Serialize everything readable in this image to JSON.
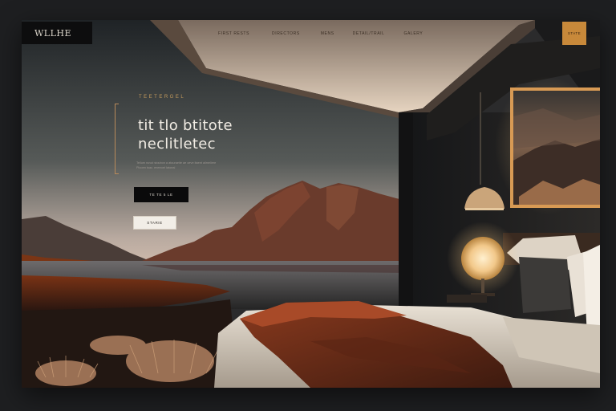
{
  "brand": {
    "logo_text": "WLLHE"
  },
  "nav": {
    "items": [
      "FIRST  RESTS",
      "DIRECTORS",
      "MENS",
      "DETAIL/TRAIL",
      "GALERY"
    ]
  },
  "cta": {
    "label": "STATE"
  },
  "hero": {
    "eyebrow": "TEETERGEL",
    "headline_line1": "tit tlo btitote",
    "headline_line2": "neclitletec",
    "body_line1": "Tellum nuvut stoubon a atouraeite ae oeve ltaent ailmeliere",
    "body_line2": "Plooen tuac. eneeoet Iatoeal",
    "primary_button": "TE TE 5 LE",
    "secondary_button": "STARIE"
  },
  "colors": {
    "accent": "#c8893a",
    "eyebrow": "#c49a5c",
    "dark": "#0d0d0e",
    "light": "#f2eee7"
  },
  "icons": [
    "pendant-lamp-icon"
  ]
}
